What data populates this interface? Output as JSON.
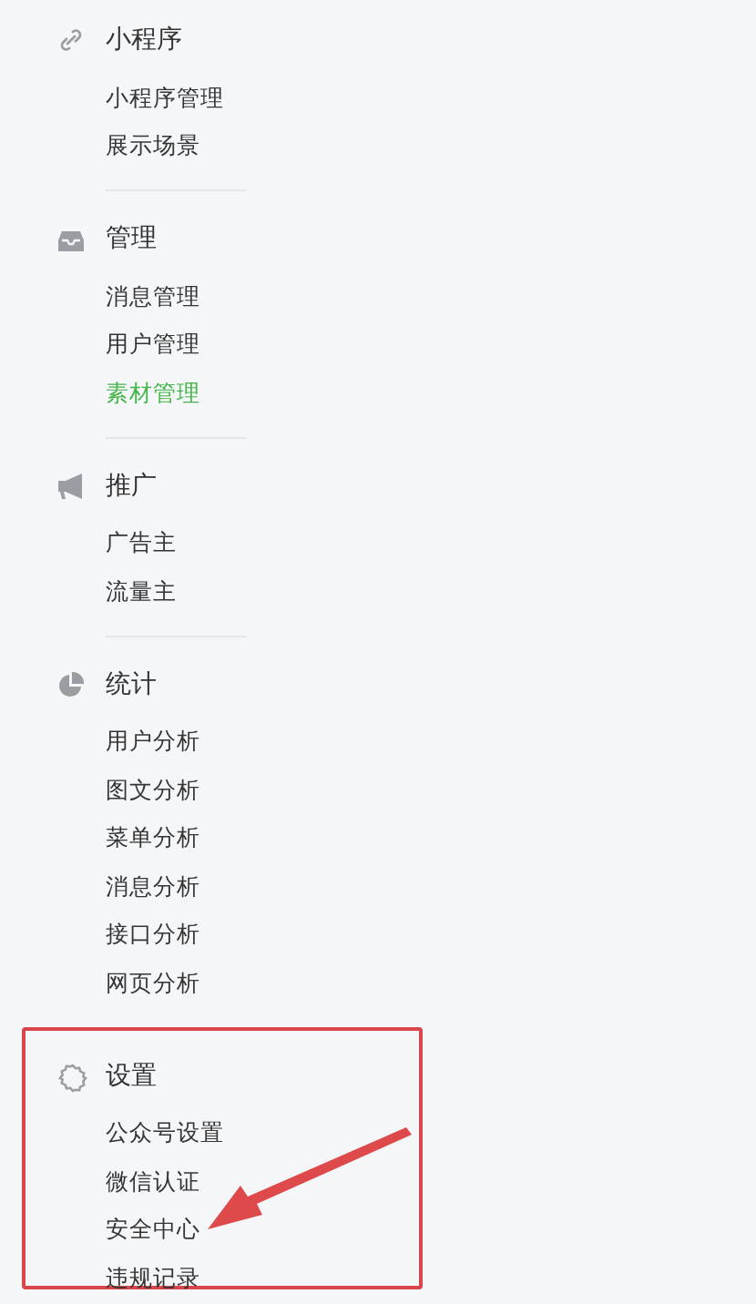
{
  "sidebar": {
    "sections": [
      {
        "title": "小程序",
        "highlighted": false,
        "items": [
          {
            "label": "小程序管理",
            "selected": false,
            "pointer": false
          },
          {
            "label": "展示场景",
            "selected": false,
            "pointer": false
          }
        ]
      },
      {
        "title": "管理",
        "highlighted": false,
        "items": [
          {
            "label": "消息管理",
            "selected": false,
            "pointer": false
          },
          {
            "label": "用户管理",
            "selected": false,
            "pointer": false
          },
          {
            "label": "素材管理",
            "selected": true,
            "pointer": false
          }
        ]
      },
      {
        "title": "推广",
        "highlighted": false,
        "items": [
          {
            "label": "广告主",
            "selected": false,
            "pointer": false
          },
          {
            "label": "流量主",
            "selected": false,
            "pointer": false
          }
        ]
      },
      {
        "title": "统计",
        "highlighted": false,
        "items": [
          {
            "label": "用户分析",
            "selected": false,
            "pointer": false
          },
          {
            "label": "图文分析",
            "selected": false,
            "pointer": false
          },
          {
            "label": "菜单分析",
            "selected": false,
            "pointer": false
          },
          {
            "label": "消息分析",
            "selected": false,
            "pointer": false
          },
          {
            "label": "接口分析",
            "selected": false,
            "pointer": false
          },
          {
            "label": "网页分析",
            "selected": false,
            "pointer": false
          }
        ]
      },
      {
        "title": "设置",
        "highlighted": true,
        "items": [
          {
            "label": "公众号设置",
            "selected": false,
            "pointer": false
          },
          {
            "label": "微信认证",
            "selected": false,
            "pointer": false
          },
          {
            "label": "安全中心",
            "selected": false,
            "pointer": true
          },
          {
            "label": "违规记录",
            "selected": false,
            "pointer": false
          }
        ]
      }
    ]
  }
}
